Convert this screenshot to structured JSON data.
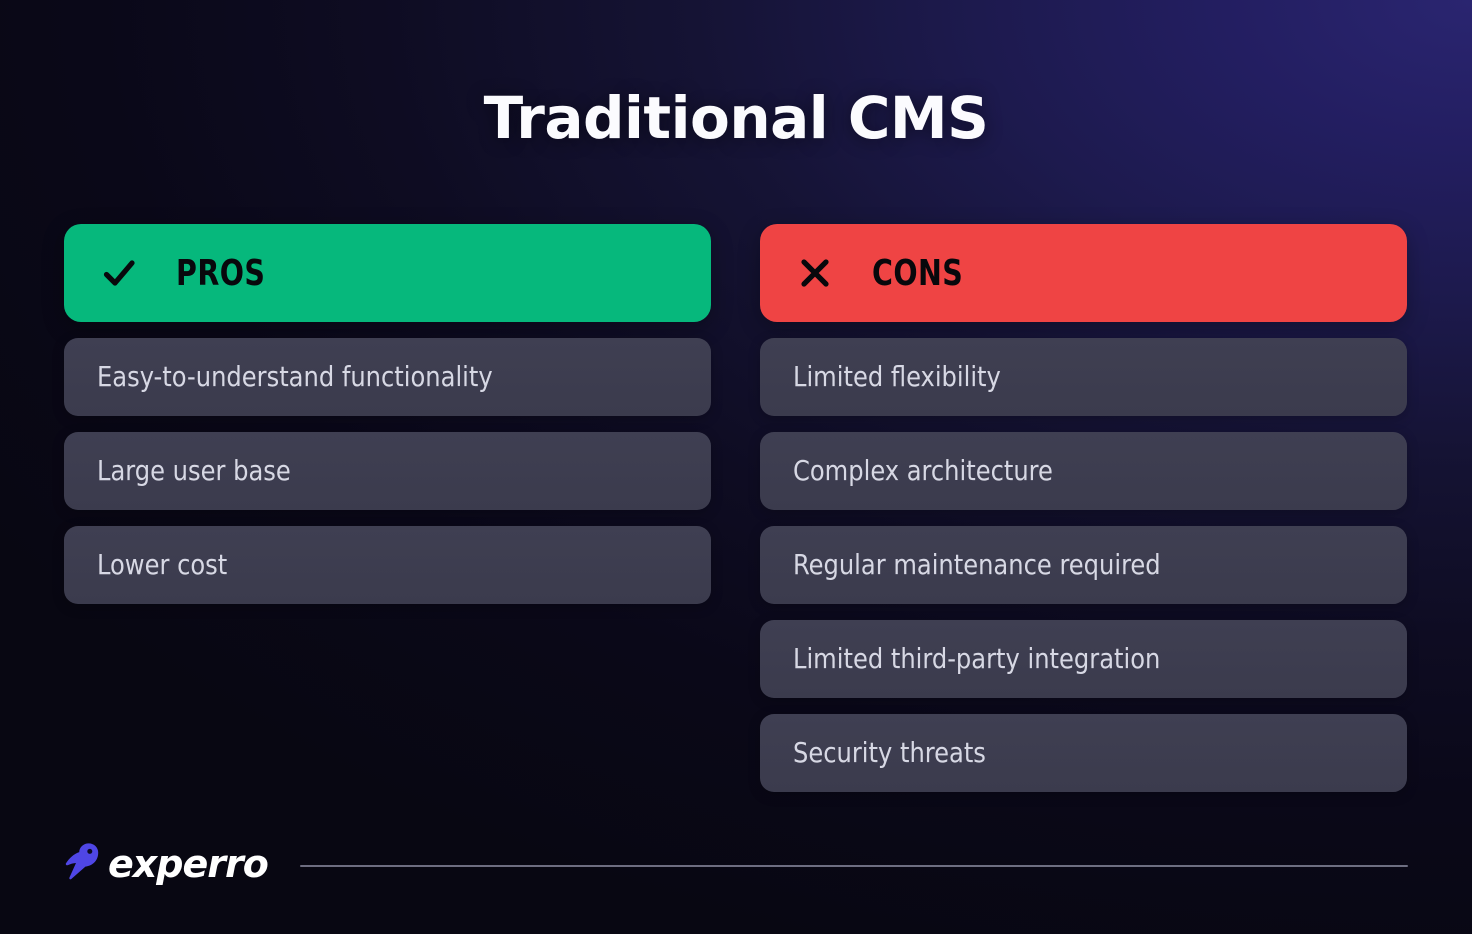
{
  "page": {
    "title": "Traditional CMS",
    "background_gradient_from": "#080712",
    "background_gradient_to": "#2a2570"
  },
  "columns": [
    {
      "key": "pros",
      "header_label": "PROS",
      "header_color": "#06b87c",
      "icon": "check-icon",
      "items": [
        "Easy-to-understand functionality",
        "Large user base",
        "Lower cost"
      ]
    },
    {
      "key": "cons",
      "header_label": "CONS",
      "header_color": "#ef4444",
      "icon": "x-icon",
      "items": [
        "Limited flexibility",
        "Complex architecture",
        "Regular maintenance required",
        "Limited third-party integration",
        "Security threats"
      ]
    }
  ],
  "footer": {
    "brand_name": "experro",
    "brand_mark": "bird-logo-icon",
    "brand_color": "#4f46e5",
    "divider_color": "#8f90a6"
  },
  "theme": {
    "card_background": "#3f3f52",
    "card_text": "#d7d8e4",
    "header_text": "#08080c",
    "title_text": "#fbfbfe"
  }
}
